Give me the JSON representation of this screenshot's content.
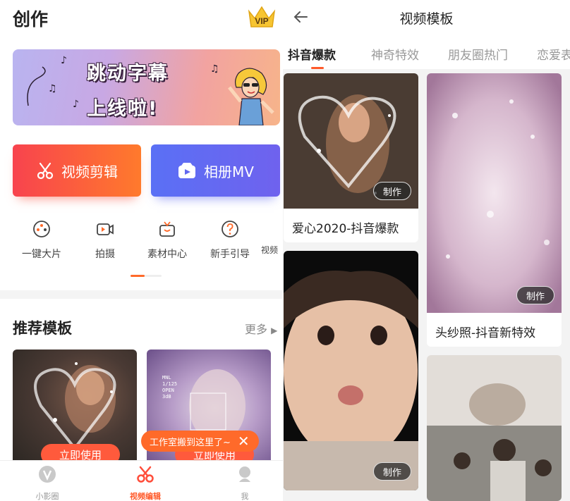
{
  "left": {
    "title": "创作",
    "vip_label": "VIP",
    "banner": {
      "line1": "跳动字幕",
      "line2": "上线啦!"
    },
    "buttons": {
      "edit": "视频剪辑",
      "mv": "相册MV"
    },
    "tools": [
      "一键大片",
      "拍摄",
      "素材中心",
      "新手引导",
      "视频"
    ],
    "section_title": "推荐模板",
    "more_label": "更多",
    "use_label": "立即使用",
    "card2_overlay": [
      "MNL",
      "1/125",
      "OPEN",
      "3dB"
    ],
    "toast": "工作室搬到这里了~",
    "tabbar": [
      "小影圈",
      "视频编辑",
      "我"
    ],
    "accent": "#ff5a2a"
  },
  "right": {
    "title": "视频模板",
    "tabs": [
      "抖音爆款",
      "神奇特效",
      "朋友圈热门",
      "恋爱表"
    ],
    "make_label": "制作",
    "cards": [
      {
        "caption": "爱心2020-抖音爆款"
      },
      {
        "caption": "头纱照-抖音新特效"
      },
      {
        "caption": ""
      },
      {
        "caption": ""
      }
    ]
  }
}
